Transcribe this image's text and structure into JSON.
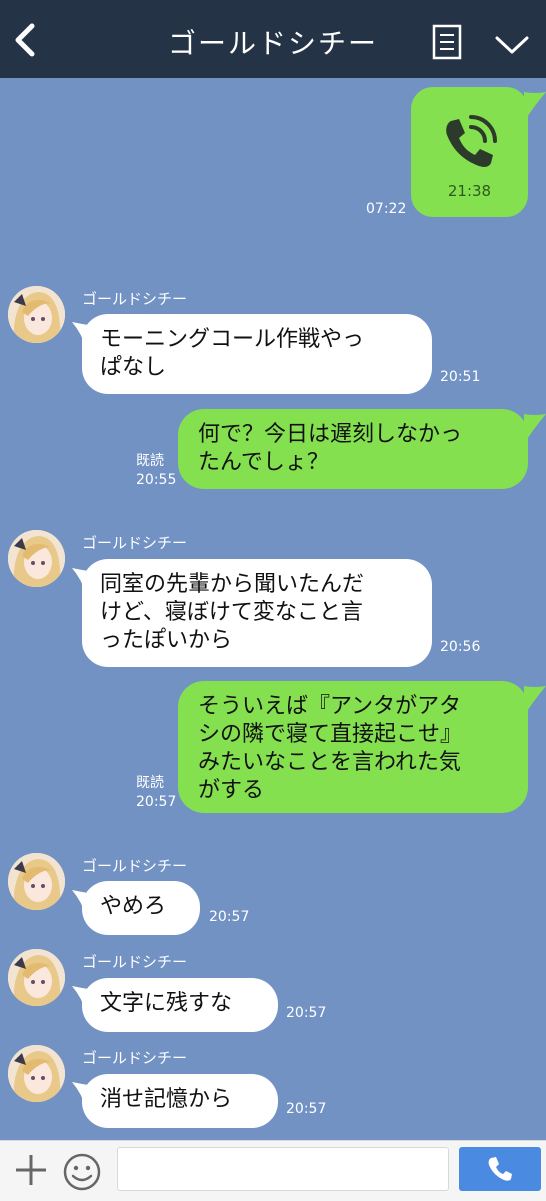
{
  "header": {
    "title": "ゴールドシチー"
  },
  "call": {
    "duration": "21:38",
    "time": "07:22"
  },
  "messages": [
    {
      "sender": "ゴールドシチー",
      "lines": [
        "モーニングコール作戦やっ",
        "ぱなし"
      ],
      "time": "20:51"
    },
    {
      "lines": [
        "何で？今日は遅刻しなかっ",
        "たんでしょ？"
      ],
      "read": "既読",
      "time": "20:55"
    },
    {
      "sender": "ゴールドシチー",
      "lines": [
        "同室の先輩から聞いたんだ",
        "けど、寝ぼけて変なこと言",
        "ったぽいから"
      ],
      "time": "20:56"
    },
    {
      "lines": [
        "そういえば『アンタがアタ",
        "シの隣で寝て直接起こせ』",
        "みたいなことを言われた気",
        "がする"
      ],
      "read": "既読",
      "time": "20:57"
    },
    {
      "sender": "ゴールドシチー",
      "lines": [
        "やめろ"
      ],
      "time": "20:57"
    },
    {
      "sender": "ゴールドシチー",
      "lines": [
        "文字に残すな"
      ],
      "time": "20:57"
    },
    {
      "sender": "ゴールドシチー",
      "lines": [
        "消せ記憶から"
      ],
      "time": "20:57"
    }
  ],
  "input": {
    "value": ""
  },
  "colors": {
    "background": "#7292c4",
    "header": "#253347",
    "outgoing_bubble": "#84e04f",
    "incoming_bubble": "#ffffff",
    "call_button": "#4a8ae0"
  },
  "icons": {
    "back": "back-arrow-icon",
    "menu": "menu-list-icon",
    "expand": "chevron-down-icon",
    "call": "phone-call-icon",
    "plus": "plus-icon",
    "emoji": "emoji-icon",
    "phone": "phone-icon"
  }
}
